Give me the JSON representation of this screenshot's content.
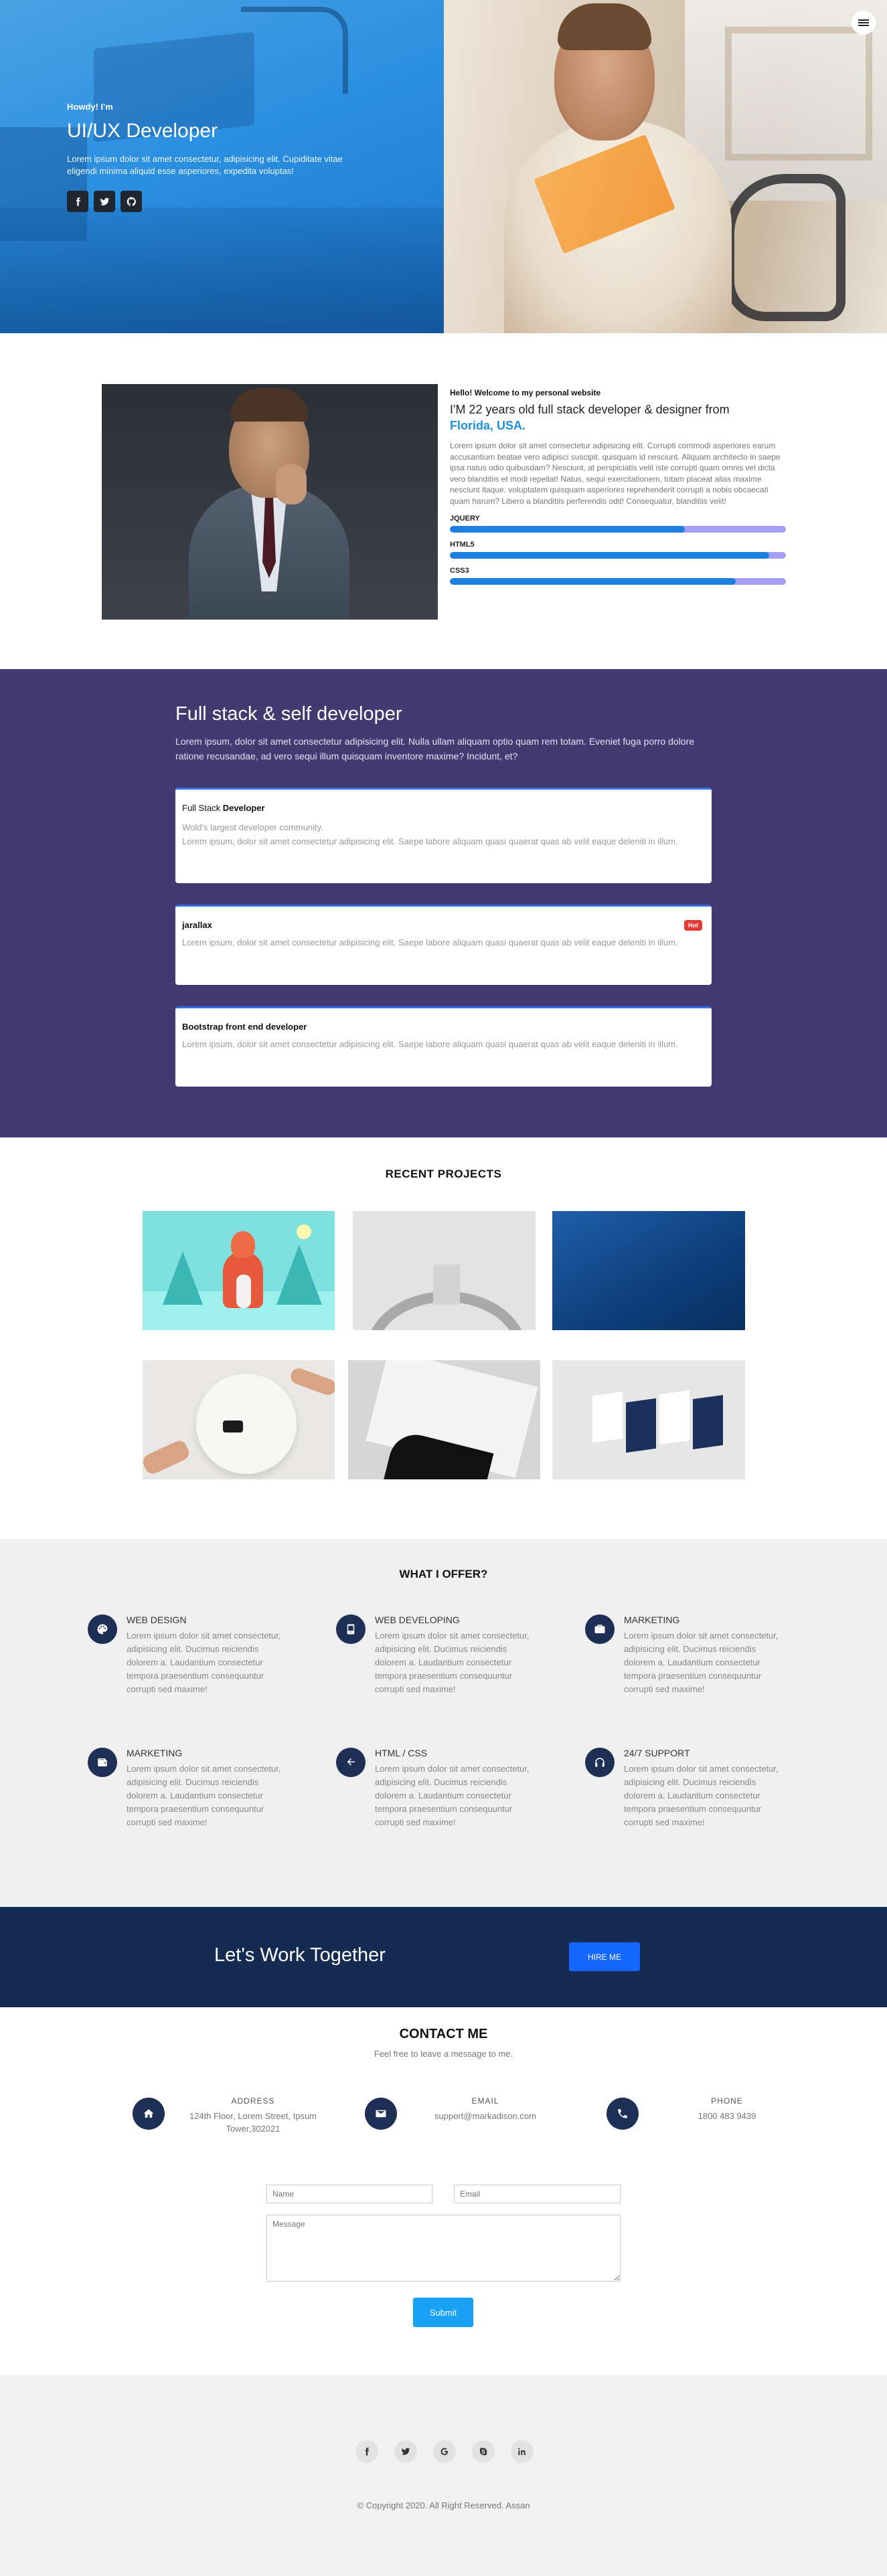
{
  "hero": {
    "greeting": "Howdy! I'm",
    "title": "UI/UX Developer",
    "description": "Lorem ipsum dolor sit amet consectetur, adipisicing elit. Cupiditate vitae eligendi minima aliquid esse asperiores, expedita voluptas!",
    "social": [
      "facebook-icon",
      "twitter-icon",
      "github-icon"
    ]
  },
  "about": {
    "hello": "Hello! Welcome to my personal website",
    "line": "I'M 22 years old full stack developer & designer from",
    "location": "Florida, USA.",
    "paragraph": "Lorem ipsum dolor sit amet consectetur adipisicing elit. Corrupti commodi asperiores earum accusantium beatae vero adipisci suscipit. quisquam id nesciunt. Aliquam architecto in saepe ipsa natus odio quibusdam? Nesciunt, at perspiciatis velit iste corrupti quam omnis vel dicta vero blanditiis et modi repellat! Natus, sequi exercitationem, totam placeat alias maxime nesciunt itaque. voluptatem quisquam asperiores reprehenderit corrupti a nobis obcaecati quam harum? Libero a blanditiis perferendis odit! Consequatur, blanditiis velit!",
    "skills": [
      {
        "name": "JQUERY",
        "level": 0.7
      },
      {
        "name": "HTML5",
        "level": 0.95
      },
      {
        "name": "CSS3",
        "level": 0.85
      }
    ]
  },
  "fullstack": {
    "title": "Full stack & self developer",
    "description": "Lorem ipsum, dolor sit amet consectetur adipisicing elit. Nulla ullam aliquam optio quam rem totam. Eveniet fuga porro dolore ratione recusandae, ad vero sequi illum quisquam inventore maxime? Incidunt, et?",
    "cards": [
      {
        "title_prefix": "Full Stack",
        "title_bold": "Developer",
        "subtitle": "Wold's largest developer community.",
        "text": "Lorem ipsum, dolor sit amet consectetur adipisicing elit. Saepe labore aliquam quasi quaerat quas ab velit eaque deleniti in illum.",
        "badge": ""
      },
      {
        "title_prefix": "",
        "title_bold": "jarallax",
        "subtitle": "",
        "text": "Lorem ipsum, dolor sit amet consectetur adipisicing elit. Saepe labore aliquam quasi quaerat quas ab velit eaque deleniti in illum.",
        "badge": "Hot"
      },
      {
        "title_prefix": "",
        "title_bold": "Bootstrap front end developer",
        "subtitle": "",
        "text": "Lorem ipsum, dolor sit amet consectetur adipisicing elit. Saepe labore aliquam quasi quaerat quas ab velit eaque deleniti in illum.",
        "badge": ""
      }
    ]
  },
  "projects": {
    "title": "RECENT PROJECTS"
  },
  "offer": {
    "title": "WHAT I OFFER?",
    "services": [
      {
        "name": "WEB DESIGN",
        "icon": "palette-icon",
        "desc": "Lorem ipsum dolor sit amet consectetur, adipisicing elit. Ducimus reiciendis dolorem a. Laudantium consectetur tempora praesentium consequuntur corrupti sed maxime!"
      },
      {
        "name": "WEB DEVELOPING",
        "icon": "mobile-icon",
        "desc": "Lorem ipsum dolor sit amet consectetur, adipisicing elit. Ducimus reiciendis dolorem a. Laudantium consectetur tempora praesentium consequuntur corrupti sed maxime!"
      },
      {
        "name": "MARKETING",
        "icon": "briefcase-icon",
        "desc": "Lorem ipsum dolor sit amet consectetur, adipisicing elit. Ducimus reiciendis dolorem a. Laudantium consectetur tempora praesentium consequuntur corrupti sed maxime!"
      },
      {
        "name": "MARKETING",
        "icon": "wallet-icon",
        "desc": "Lorem ipsum dolor sit amet consectetur, adipisicing elit. Ducimus reiciendis dolorem a. Laudantium consectetur tempora praesentium consequuntur corrupti sed maxime!"
      },
      {
        "name": "HTML / CSS",
        "icon": "arrow-left-icon",
        "desc": "Lorem ipsum dolor sit amet consectetur, adipisicing elit. Ducimus reiciendis dolorem a. Laudantium consectetur tempora praesentium consequuntur corrupti sed maxime!"
      },
      {
        "name": "24/7 SUPPORT",
        "icon": "headphones-icon",
        "desc": "Lorem ipsum dolor sit amet consectetur, adipisicing elit. Ducimus reiciendis dolorem a. Laudantium consectetur tempora praesentium consequuntur corrupti sed maxime!"
      }
    ]
  },
  "cta": {
    "text": "Let's Work Together",
    "button": "HIRE ME"
  },
  "contact": {
    "title": "CONTACT ME",
    "subtitle": "Feel free to leave a message to me.",
    "info": [
      {
        "label": "ADDRESS",
        "value": "124th Floor, Lorem Street, Ipsum Tower,302021",
        "icon": "home-icon"
      },
      {
        "label": "EMAIL",
        "value": "support@markadison.com",
        "icon": "envelope-icon"
      },
      {
        "label": "PHONE",
        "value": "1800 483 9439",
        "icon": "phone-icon"
      }
    ],
    "form": {
      "name_placeholder": "Name",
      "email_placeholder": "Email",
      "message_placeholder": "Message",
      "submit": "Submit"
    }
  },
  "footer": {
    "social": [
      "facebook-icon",
      "twitter-icon",
      "google-icon",
      "skype-icon",
      "linkedin-icon"
    ],
    "copyright": "© Copyright 2020. All Right Reserved. Assan"
  }
}
